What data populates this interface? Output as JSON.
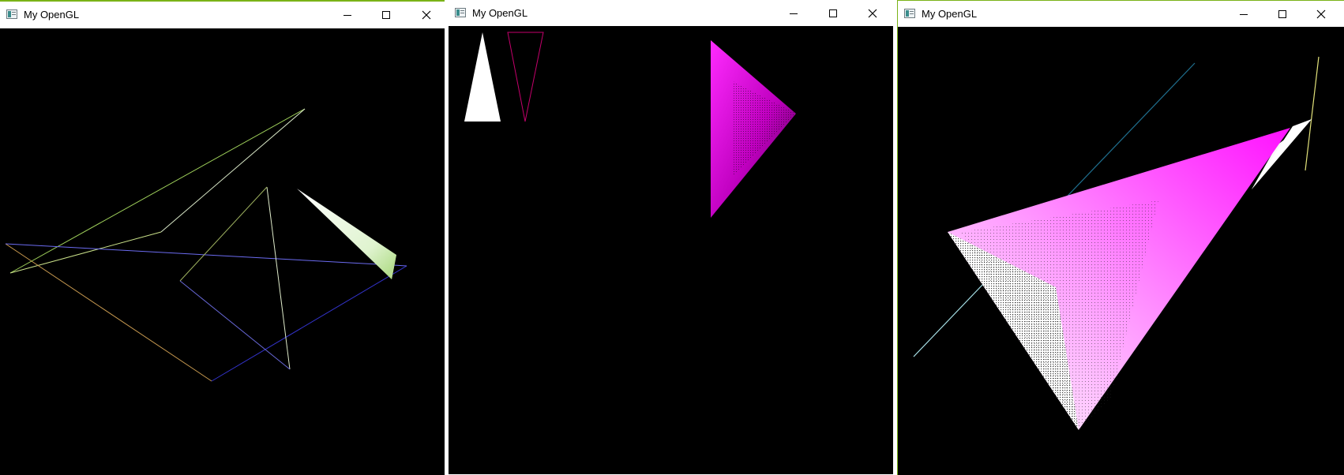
{
  "windows": [
    {
      "title": "My OpenGL",
      "controls": {
        "minimize": "minimize-icon",
        "maximize": "maximize-icon",
        "close": "close-icon"
      }
    },
    {
      "title": "My OpenGL",
      "controls": {
        "minimize": "minimize-icon",
        "maximize": "maximize-icon",
        "close": "close-icon"
      }
    },
    {
      "title": "My OpenGL",
      "controls": {
        "minimize": "minimize-icon",
        "maximize": "maximize-icon",
        "close": "close-icon"
      }
    }
  ],
  "colors": {
    "titlebar_bg": "#ffffff",
    "client_bg": "#000000",
    "accent_border": "#7ab317",
    "magenta": "#ff00ff",
    "white": "#ffffff"
  }
}
